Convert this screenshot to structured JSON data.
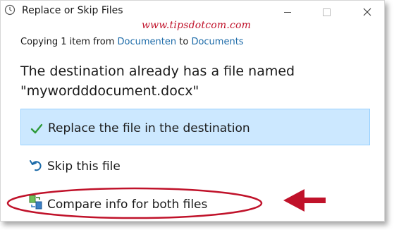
{
  "window": {
    "title": "Replace or Skip Files",
    "watermark": "www.tipsdotcom.com"
  },
  "status": {
    "prefix": "Copying 1 item from ",
    "source": "Documenten",
    "connector": " to ",
    "destination": "Documents"
  },
  "message": {
    "line1": "The destination already has a file named",
    "line2": "\"mywordddocument.docx\""
  },
  "options": {
    "replace": "Replace the file in the destination",
    "skip": "Skip this file",
    "compare": "Compare info for both files"
  },
  "colors": {
    "link": "#1b6aa8",
    "selected_bg": "#cce8ff",
    "annotation": "#c0122a",
    "check": "#2e9a3a"
  },
  "icons": {
    "app": "clock-icon",
    "replace": "checkmark-icon",
    "skip": "undo-arrow-icon",
    "compare": "compare-files-icon",
    "minimize": "minimize-icon",
    "maximize": "maximize-icon",
    "close": "close-icon"
  }
}
